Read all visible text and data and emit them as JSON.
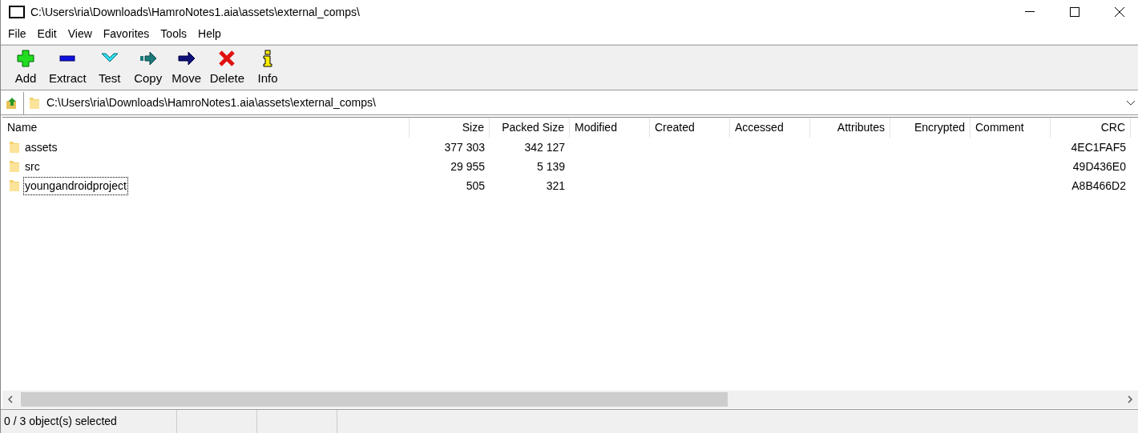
{
  "window": {
    "title": "C:\\Users\\ria\\Downloads\\HamroNotes1.aia\\assets\\external_comps\\"
  },
  "menu": [
    "File",
    "Edit",
    "View",
    "Favorites",
    "Tools",
    "Help"
  ],
  "toolbar": [
    {
      "kind": "add",
      "label": "Add"
    },
    {
      "kind": "extract",
      "label": "Extract"
    },
    {
      "kind": "test",
      "label": "Test"
    },
    {
      "kind": "copy",
      "label": "Copy"
    },
    {
      "kind": "move",
      "label": "Move"
    },
    {
      "kind": "delete",
      "label": "Delete"
    },
    {
      "kind": "info",
      "label": "Info"
    }
  ],
  "address": {
    "value": "C:\\Users\\ria\\Downloads\\HamroNotes1.aia\\assets\\external_comps\\"
  },
  "table": {
    "columns": [
      "Name",
      "Size",
      "Packed Size",
      "Modified",
      "Created",
      "Accessed",
      "Attributes",
      "Encrypted",
      "Comment",
      "CRC"
    ],
    "rows": [
      {
        "name": "assets",
        "size": "377 303",
        "packed_size": "342 127",
        "crc": "4EC1FAF5",
        "focused": false
      },
      {
        "name": "src",
        "size": "29 955",
        "packed_size": "5 139",
        "crc": "49D436E0",
        "focused": false
      },
      {
        "name": "youngandroidproject",
        "size": "505",
        "packed_size": "321",
        "crc": "A8B466D2",
        "focused": true
      }
    ]
  },
  "status_bar": {
    "text": "0 / 3 object(s) selected"
  }
}
